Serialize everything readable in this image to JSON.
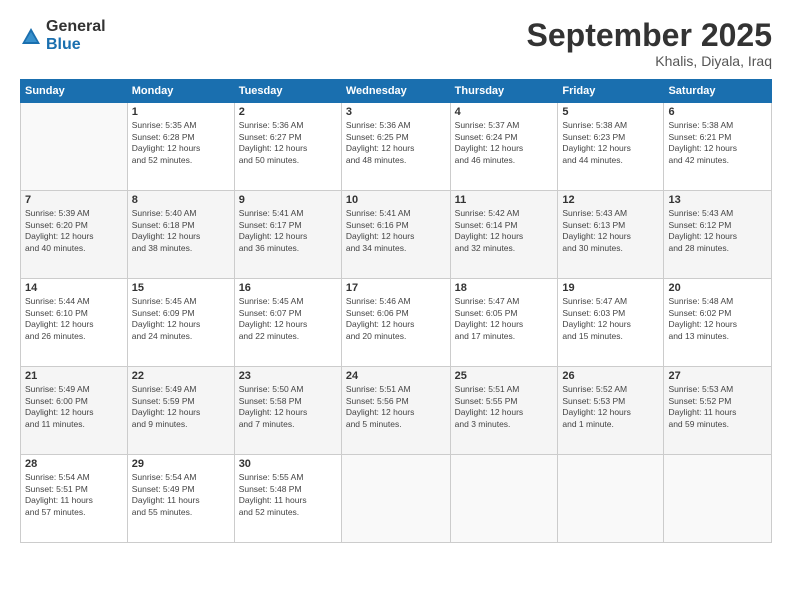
{
  "logo": {
    "general": "General",
    "blue": "Blue"
  },
  "title": "September 2025",
  "location": "Khalis, Diyala, Iraq",
  "days_header": [
    "Sunday",
    "Monday",
    "Tuesday",
    "Wednesday",
    "Thursday",
    "Friday",
    "Saturday"
  ],
  "weeks": [
    [
      {
        "day": "",
        "info": ""
      },
      {
        "day": "1",
        "info": "Sunrise: 5:35 AM\nSunset: 6:28 PM\nDaylight: 12 hours\nand 52 minutes."
      },
      {
        "day": "2",
        "info": "Sunrise: 5:36 AM\nSunset: 6:27 PM\nDaylight: 12 hours\nand 50 minutes."
      },
      {
        "day": "3",
        "info": "Sunrise: 5:36 AM\nSunset: 6:25 PM\nDaylight: 12 hours\nand 48 minutes."
      },
      {
        "day": "4",
        "info": "Sunrise: 5:37 AM\nSunset: 6:24 PM\nDaylight: 12 hours\nand 46 minutes."
      },
      {
        "day": "5",
        "info": "Sunrise: 5:38 AM\nSunset: 6:23 PM\nDaylight: 12 hours\nand 44 minutes."
      },
      {
        "day": "6",
        "info": "Sunrise: 5:38 AM\nSunset: 6:21 PM\nDaylight: 12 hours\nand 42 minutes."
      }
    ],
    [
      {
        "day": "7",
        "info": "Sunrise: 5:39 AM\nSunset: 6:20 PM\nDaylight: 12 hours\nand 40 minutes."
      },
      {
        "day": "8",
        "info": "Sunrise: 5:40 AM\nSunset: 6:18 PM\nDaylight: 12 hours\nand 38 minutes."
      },
      {
        "day": "9",
        "info": "Sunrise: 5:41 AM\nSunset: 6:17 PM\nDaylight: 12 hours\nand 36 minutes."
      },
      {
        "day": "10",
        "info": "Sunrise: 5:41 AM\nSunset: 6:16 PM\nDaylight: 12 hours\nand 34 minutes."
      },
      {
        "day": "11",
        "info": "Sunrise: 5:42 AM\nSunset: 6:14 PM\nDaylight: 12 hours\nand 32 minutes."
      },
      {
        "day": "12",
        "info": "Sunrise: 5:43 AM\nSunset: 6:13 PM\nDaylight: 12 hours\nand 30 minutes."
      },
      {
        "day": "13",
        "info": "Sunrise: 5:43 AM\nSunset: 6:12 PM\nDaylight: 12 hours\nand 28 minutes."
      }
    ],
    [
      {
        "day": "14",
        "info": "Sunrise: 5:44 AM\nSunset: 6:10 PM\nDaylight: 12 hours\nand 26 minutes."
      },
      {
        "day": "15",
        "info": "Sunrise: 5:45 AM\nSunset: 6:09 PM\nDaylight: 12 hours\nand 24 minutes."
      },
      {
        "day": "16",
        "info": "Sunrise: 5:45 AM\nSunset: 6:07 PM\nDaylight: 12 hours\nand 22 minutes."
      },
      {
        "day": "17",
        "info": "Sunrise: 5:46 AM\nSunset: 6:06 PM\nDaylight: 12 hours\nand 20 minutes."
      },
      {
        "day": "18",
        "info": "Sunrise: 5:47 AM\nSunset: 6:05 PM\nDaylight: 12 hours\nand 17 minutes."
      },
      {
        "day": "19",
        "info": "Sunrise: 5:47 AM\nSunset: 6:03 PM\nDaylight: 12 hours\nand 15 minutes."
      },
      {
        "day": "20",
        "info": "Sunrise: 5:48 AM\nSunset: 6:02 PM\nDaylight: 12 hours\nand 13 minutes."
      }
    ],
    [
      {
        "day": "21",
        "info": "Sunrise: 5:49 AM\nSunset: 6:00 PM\nDaylight: 12 hours\nand 11 minutes."
      },
      {
        "day": "22",
        "info": "Sunrise: 5:49 AM\nSunset: 5:59 PM\nDaylight: 12 hours\nand 9 minutes."
      },
      {
        "day": "23",
        "info": "Sunrise: 5:50 AM\nSunset: 5:58 PM\nDaylight: 12 hours\nand 7 minutes."
      },
      {
        "day": "24",
        "info": "Sunrise: 5:51 AM\nSunset: 5:56 PM\nDaylight: 12 hours\nand 5 minutes."
      },
      {
        "day": "25",
        "info": "Sunrise: 5:51 AM\nSunset: 5:55 PM\nDaylight: 12 hours\nand 3 minutes."
      },
      {
        "day": "26",
        "info": "Sunrise: 5:52 AM\nSunset: 5:53 PM\nDaylight: 12 hours\nand 1 minute."
      },
      {
        "day": "27",
        "info": "Sunrise: 5:53 AM\nSunset: 5:52 PM\nDaylight: 11 hours\nand 59 minutes."
      }
    ],
    [
      {
        "day": "28",
        "info": "Sunrise: 5:54 AM\nSunset: 5:51 PM\nDaylight: 11 hours\nand 57 minutes."
      },
      {
        "day": "29",
        "info": "Sunrise: 5:54 AM\nSunset: 5:49 PM\nDaylight: 11 hours\nand 55 minutes."
      },
      {
        "day": "30",
        "info": "Sunrise: 5:55 AM\nSunset: 5:48 PM\nDaylight: 11 hours\nand 52 minutes."
      },
      {
        "day": "",
        "info": ""
      },
      {
        "day": "",
        "info": ""
      },
      {
        "day": "",
        "info": ""
      },
      {
        "day": "",
        "info": ""
      }
    ]
  ]
}
